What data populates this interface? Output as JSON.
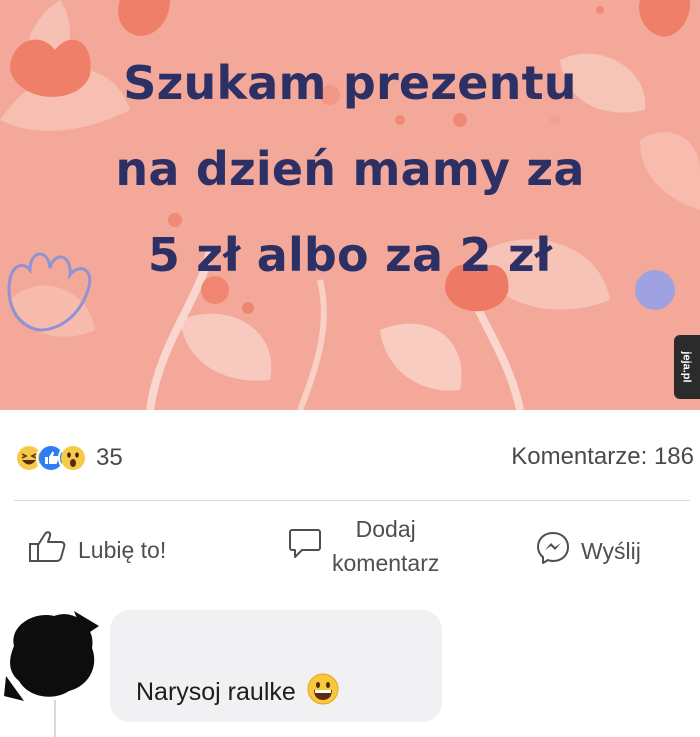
{
  "banner": {
    "title_lines": [
      "Szukam prezentu",
      "na dzień mamy za",
      "5 zł albo za 2 zł"
    ],
    "background_color": "#f4a89a",
    "title_color": "#2c3064",
    "watermark": "jeja.pl"
  },
  "stats": {
    "reaction_icons": [
      "haha-icon",
      "like-icon",
      "wow-icon"
    ],
    "reaction_count": "35",
    "comments_label": "Komentarze: 186"
  },
  "actions": {
    "like_label": "Lubię to!",
    "comment_label_line1": "Dodaj",
    "comment_label_line2": "komentarz",
    "share_label": "Wyślij"
  },
  "comment": {
    "text": "Narysoj raulke",
    "emoji_icon": "grinning-face-icon"
  }
}
